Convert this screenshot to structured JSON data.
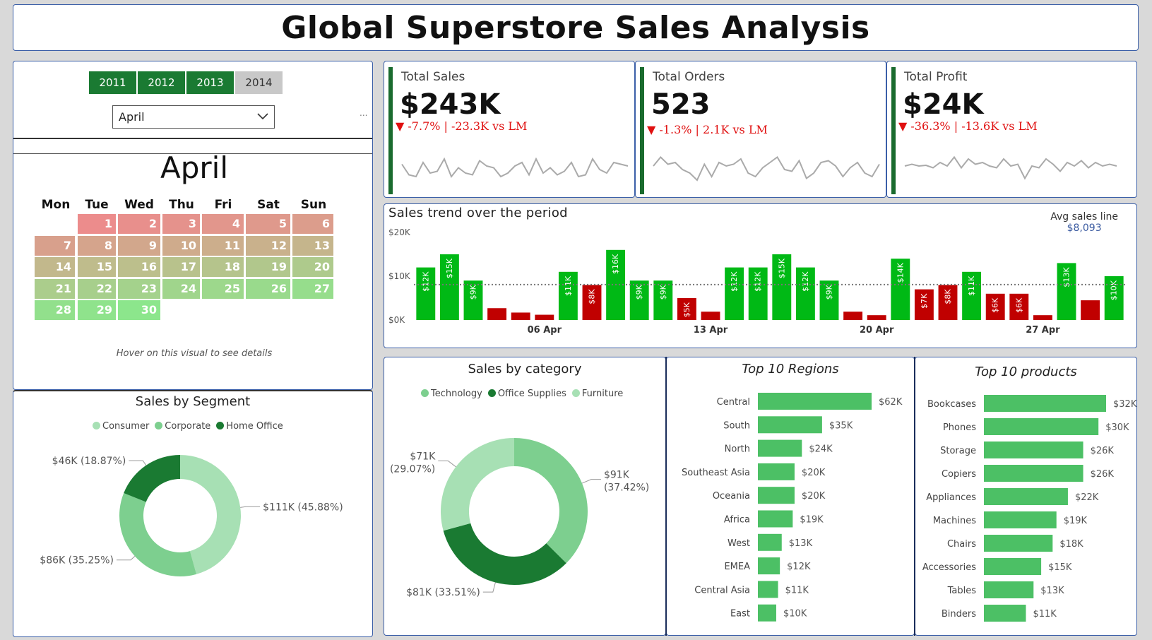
{
  "title": "Global Superstore Sales Analysis",
  "slicer": {
    "years": [
      {
        "label": "2011",
        "selected": true
      },
      {
        "label": "2012",
        "selected": true
      },
      {
        "label": "2013",
        "selected": true
      },
      {
        "label": "2014",
        "selected": false
      }
    ],
    "month": "April",
    "more": "..."
  },
  "calendar": {
    "month": "April",
    "weekdays": [
      "Mon",
      "Tue",
      "Wed",
      "Thu",
      "Fri",
      "Sat",
      "Sun"
    ],
    "start_weekday": 1,
    "days": 30,
    "hover_note": "Hover on this visual to see details"
  },
  "kpis": [
    {
      "title": "Total Sales",
      "value": "$243K",
      "delta": "▼ -7.7% | -23.3K vs LM",
      "spark": [
        0.55,
        0.25,
        0.2,
        0.6,
        0.3,
        0.35,
        0.7,
        0.2,
        0.45,
        0.3,
        0.25,
        0.65,
        0.5,
        0.45,
        0.2,
        0.3,
        0.5,
        0.6,
        0.25,
        0.7,
        0.3,
        0.45,
        0.25,
        0.35,
        0.6,
        0.2,
        0.25,
        0.7,
        0.4,
        0.3,
        0.6,
        0.55,
        0.5
      ]
    },
    {
      "title": "Total Orders",
      "value": "523",
      "delta": "▼ -1.3% | 2.1K vs LM",
      "spark": [
        0.5,
        0.75,
        0.55,
        0.6,
        0.4,
        0.3,
        0.1,
        0.55,
        0.2,
        0.6,
        0.5,
        0.55,
        0.7,
        0.3,
        0.2,
        0.45,
        0.6,
        0.75,
        0.4,
        0.35,
        0.65,
        0.15,
        0.3,
        0.6,
        0.65,
        0.5,
        0.2,
        0.45,
        0.6,
        0.3,
        0.2,
        0.55
      ]
    },
    {
      "title": "Total Profit",
      "value": "$24K",
      "delta": "▼ -36.3% | -13.6K vs LM",
      "spark": [
        0.5,
        0.55,
        0.5,
        0.52,
        0.45,
        0.6,
        0.5,
        0.75,
        0.45,
        0.7,
        0.55,
        0.6,
        0.5,
        0.45,
        0.7,
        0.5,
        0.55,
        0.15,
        0.5,
        0.45,
        0.7,
        0.55,
        0.35,
        0.6,
        0.5,
        0.65,
        0.45,
        0.6,
        0.5,
        0.55,
        0.5
      ]
    }
  ],
  "colors": {
    "green_bar": "#00b915",
    "red_bar": "#c00000",
    "dark_green": "#1a7a32",
    "mid_green": "#7dcf8f",
    "light_green": "#a7e0b4",
    "hbar": "#4cc065"
  },
  "chart_data": [
    {
      "type": "bar",
      "title": "Sales trend over the period",
      "annotation_label": "Avg sales line",
      "annotation_value": "$8,093",
      "average": 8093,
      "ylim": [
        0,
        20000
      ],
      "yticks": [
        "$0K",
        "$10K",
        "$20K"
      ],
      "x_labels": [
        {
          "day": 6,
          "label": "06 Apr"
        },
        {
          "day": 13,
          "label": "13 Apr"
        },
        {
          "day": 20,
          "label": "20 Apr"
        },
        {
          "day": 27,
          "label": "27 Apr"
        }
      ],
      "days": [
        1,
        2,
        3,
        4,
        5,
        6,
        7,
        8,
        9,
        10,
        11,
        12,
        13,
        14,
        15,
        16,
        17,
        18,
        19,
        20,
        21,
        22,
        23,
        24,
        25,
        26,
        27,
        28,
        29,
        30
      ],
      "values": [
        12000,
        15000,
        9000,
        2700,
        1700,
        1200,
        11000,
        8000,
        16000,
        9000,
        9000,
        5000,
        1900,
        12000,
        12000,
        15000,
        12000,
        9000,
        1900,
        1100,
        14000,
        7000,
        8000,
        11000,
        6000,
        6000,
        1100,
        13000,
        4500,
        10000
      ],
      "data_labels": [
        "$12K",
        "$15K",
        "$9K",
        "",
        "",
        "",
        "$11K",
        "$8K",
        "$16K",
        "$9K",
        "$9K",
        "$5K",
        "",
        "$12K",
        "$12K",
        "$15K",
        "$12K",
        "$9K",
        "",
        "",
        "$14K",
        "$7K",
        "$8K",
        "$11K",
        "$6K",
        "$6K",
        "",
        "$13K",
        "",
        "$10K"
      ]
    },
    {
      "type": "pie",
      "title": "Sales by Segment",
      "series": [
        {
          "name": "Consumer",
          "value": 111,
          "label": "$111K (45.88%)",
          "color": "#a7e0b4"
        },
        {
          "name": "Corporate",
          "value": 86,
          "label": "$86K (35.25%)",
          "color": "#7dcf8f"
        },
        {
          "name": "Home Office",
          "value": 46,
          "label": "$46K (18.87%)",
          "color": "#1a7a32"
        }
      ]
    },
    {
      "type": "pie",
      "title": "Sales by category",
      "series": [
        {
          "name": "Technology",
          "value": 91,
          "label1": "$91K",
          "label2": "(37.42%)",
          "color": "#7dcf8f"
        },
        {
          "name": "Office Supplies",
          "value": 81,
          "label1": "$81K (33.51%)",
          "label2": "",
          "color": "#1a7a32"
        },
        {
          "name": "Furniture",
          "value": 71,
          "label1": "$71K",
          "label2": "(29.07%)",
          "color": "#a7e0b4"
        }
      ]
    },
    {
      "type": "bar",
      "title": "Top 10 Regions",
      "categories": [
        "Central",
        "South",
        "North",
        "Southeast Asia",
        "Oceania",
        "Africa",
        "West",
        "EMEA",
        "Central Asia",
        "East"
      ],
      "values": [
        62,
        35,
        24,
        20,
        20,
        19,
        13,
        12,
        11,
        10
      ],
      "data_labels": [
        "$62K",
        "$35K",
        "$24K",
        "$20K",
        "$20K",
        "$19K",
        "$13K",
        "$12K",
        "$11K",
        "$10K"
      ]
    },
    {
      "type": "bar",
      "title": "Top 10 products",
      "categories": [
        "Bookcases",
        "Phones",
        "Storage",
        "Copiers",
        "Appliances",
        "Machines",
        "Chairs",
        "Accessories",
        "Tables",
        "Binders"
      ],
      "values": [
        32,
        30,
        26,
        26,
        22,
        19,
        18,
        15,
        13,
        11
      ],
      "data_labels": [
        "$32K",
        "$30K",
        "$26K",
        "$26K",
        "$22K",
        "$19K",
        "$18K",
        "$15K",
        "$13K",
        "$11K"
      ]
    }
  ]
}
